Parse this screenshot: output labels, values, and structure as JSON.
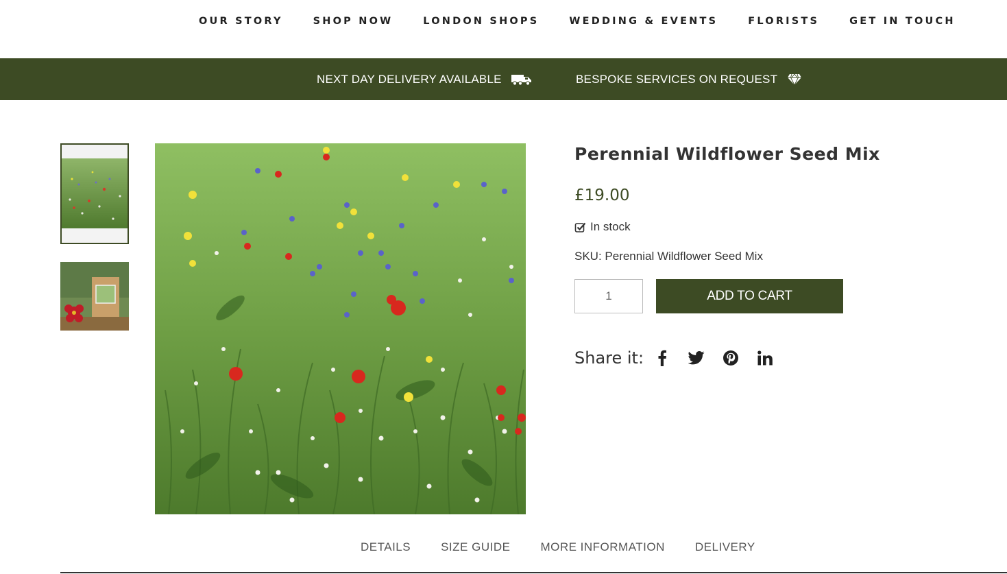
{
  "nav": {
    "items": [
      {
        "label": "OUR STORY"
      },
      {
        "label": "SHOP NOW"
      },
      {
        "label": "LONDON SHOPS"
      },
      {
        "label": "WEDDING & EVENTS"
      },
      {
        "label": "FLORISTS"
      },
      {
        "label": "GET IN TOUCH"
      }
    ]
  },
  "banner": {
    "delivery": {
      "text": "NEXT DAY DELIVERY AVAILABLE",
      "icon": "truck-icon"
    },
    "bespoke": {
      "text": "BESPOKE SERVICES ON REQUEST",
      "icon": "diamond-icon"
    }
  },
  "product": {
    "title": "Perennial Wildflower Seed Mix",
    "price": "£19.00",
    "stock": "In stock",
    "sku": "SKU: Perennial Wildflower Seed Mix",
    "quantity": "1",
    "add_to_cart": "ADD TO CART",
    "share_label": "Share it:"
  },
  "tabs": [
    {
      "label": "DETAILS"
    },
    {
      "label": "SIZE GUIDE"
    },
    {
      "label": "MORE INFORMATION"
    },
    {
      "label": "DELIVERY"
    }
  ],
  "colors": {
    "brand": "#3d4b24",
    "text": "#333333"
  }
}
